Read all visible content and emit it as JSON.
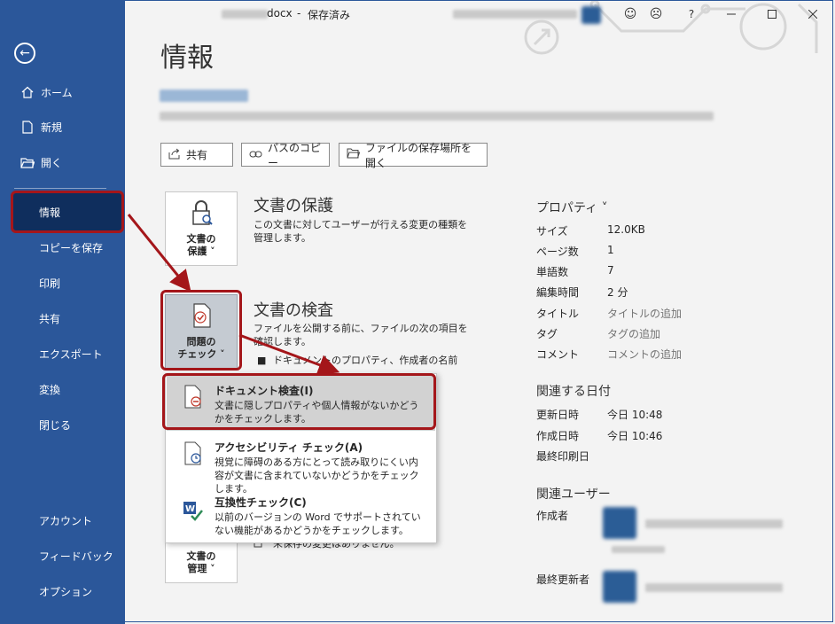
{
  "titlebar": {
    "filename_suffix": "docx",
    "status": "保存済み",
    "separator": "-",
    "help": "?"
  },
  "sidebar": {
    "back_icon": "back-arrow-icon",
    "items": [
      {
        "label": "ホーム",
        "icon": "home-icon"
      },
      {
        "label": "新規",
        "icon": "new-document-icon"
      },
      {
        "label": "開く",
        "icon": "open-folder-icon"
      },
      {
        "label": "情報",
        "active": true
      },
      {
        "label": "コピーを保存"
      },
      {
        "label": "印刷"
      },
      {
        "label": "共有"
      },
      {
        "label": "エクスポート"
      },
      {
        "label": "変換"
      },
      {
        "label": "閉じる"
      },
      {
        "label": "アカウント"
      },
      {
        "label": "フィードバック"
      },
      {
        "label": "オプション"
      }
    ],
    "accent": "#2b579a",
    "active_bg": "#0f2e5d"
  },
  "main": {
    "title": "情報",
    "toolbar": {
      "share": "共有",
      "copy_path": "パスのコピー",
      "open_location": "ファイルの保存場所を開く"
    },
    "protect": {
      "button_line1": "文書の",
      "button_line2": "保護 ˅",
      "title": "文書の保護",
      "desc": "この文書に対してユーザーが行える変更の種類を管理します。"
    },
    "inspect": {
      "button_line1": "問題の",
      "button_line2": "チェック ˅",
      "title": "文書の検査",
      "desc": "ファイルを公開する前に、ファイルの次の項目を確認します。",
      "bullet": "ドキュメントのプロパティ、作成者の名前"
    },
    "manage": {
      "button_line1": "文書の",
      "button_line2": "管理 ˅",
      "note": "未保存の変更はありません。"
    }
  },
  "dropdown": {
    "items": [
      {
        "title": "ドキュメント検査(I)",
        "desc": "文書に隠しプロパティや個人情報がないかどうかをチェックします。",
        "icon": "document-inspect-icon",
        "highlighted": true
      },
      {
        "title": "アクセシビリティ チェック(A)",
        "desc": "視覚に障碍のある方にとって読み取りにくい内容が文書に含まれていないかどうかをチェックします。",
        "icon": "accessibility-check-icon"
      },
      {
        "title": "互換性チェック(C)",
        "desc": "以前のバージョンの Word でサポートされていない機能があるかどうかをチェックします。",
        "icon": "compatibility-check-icon"
      }
    ]
  },
  "properties": {
    "heading": "プロパティ ˅",
    "rows": [
      {
        "label": "サイズ",
        "value": "12.0KB"
      },
      {
        "label": "ページ数",
        "value": "1"
      },
      {
        "label": "単語数",
        "value": "7"
      },
      {
        "label": "編集時間",
        "value": "2 分"
      },
      {
        "label": "タイトル",
        "value": "タイトルの追加",
        "placeholder": true
      },
      {
        "label": "タグ",
        "value": "タグの追加",
        "placeholder": true
      },
      {
        "label": "コメント",
        "value": "コメントの追加",
        "placeholder": true
      }
    ],
    "dates_heading": "関連する日付",
    "dates": [
      {
        "label": "更新日時",
        "value": "今日 10:48"
      },
      {
        "label": "作成日時",
        "value": "今日 10:46"
      },
      {
        "label": "最終印刷日",
        "value": ""
      }
    ],
    "users_heading": "関連ユーザー",
    "users": [
      {
        "label": "作成者"
      },
      {
        "label": "最終更新者"
      }
    ]
  },
  "callout_color": "#a4161a"
}
